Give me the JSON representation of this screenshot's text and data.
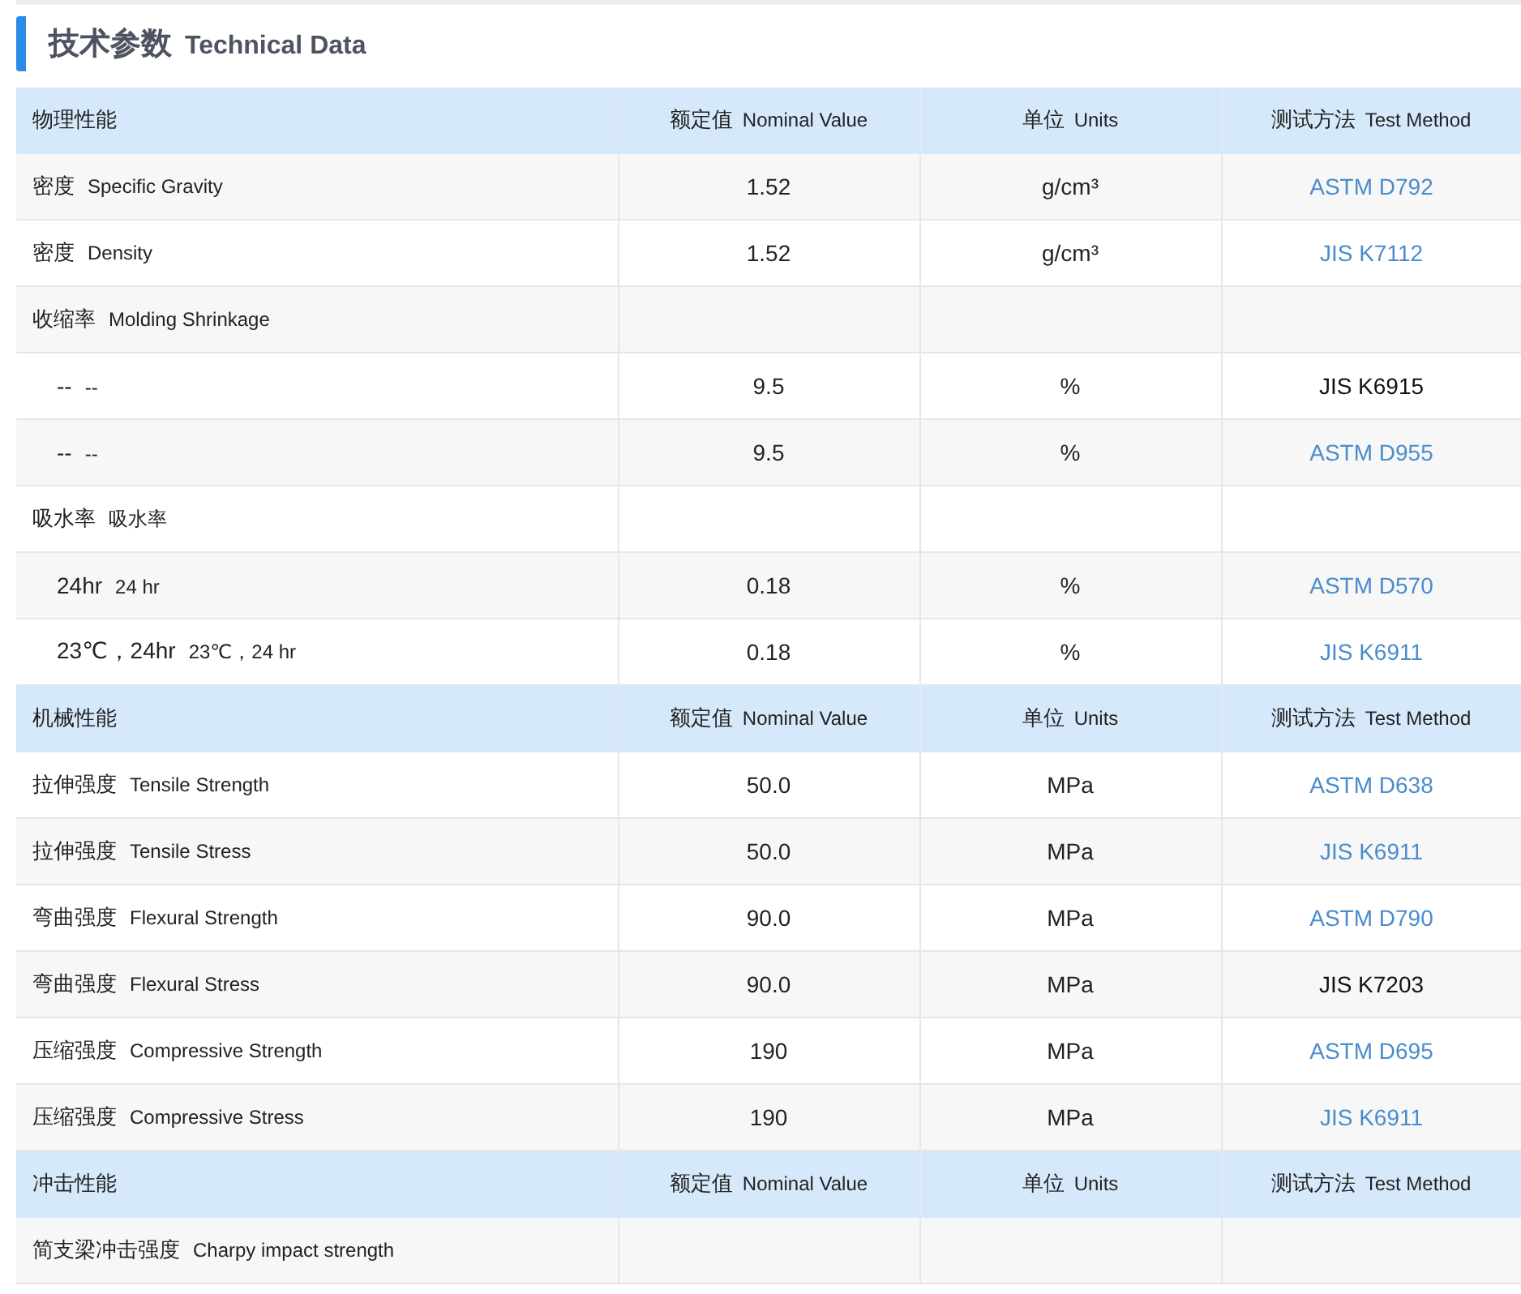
{
  "title": {
    "cn": "技术参数",
    "en": "Technical Data"
  },
  "sections": [
    {
      "header": {
        "category": "物理性能",
        "value": {
          "cn": "额定值",
          "en": "Nominal Value"
        },
        "unit": {
          "cn": "单位",
          "en": "Units"
        },
        "method": {
          "cn": "测试方法",
          "en": "Test Method"
        }
      },
      "rows": [
        {
          "cn": "密度",
          "en": "Specific Gravity",
          "value": "1.52",
          "unit": "g/cm³",
          "method": "ASTM D792",
          "link": true
        },
        {
          "cn": "密度",
          "en": "Density",
          "value": "1.52",
          "unit": "g/cm³",
          "method": "JIS K7112",
          "link": true
        },
        {
          "cn": "收缩率",
          "en": "Molding Shrinkage",
          "children": [
            {
              "cn": "--",
              "en": "--",
              "value": "9.5",
              "unit": "%",
              "method": "JIS K6915",
              "link": false
            },
            {
              "cn": "--",
              "en": "--",
              "value": "9.5",
              "unit": "%",
              "method": "ASTM D955",
              "link": true
            }
          ]
        },
        {
          "cn": "吸水率",
          "en": "吸水率",
          "children": [
            {
              "cn": "24hr",
              "en": "24 hr",
              "value": "0.18",
              "unit": "%",
              "method": "ASTM D570",
              "link": true
            },
            {
              "cn": "23℃，24hr",
              "en": "23℃，24 hr",
              "value": "0.18",
              "unit": "%",
              "method": "JIS K6911",
              "link": true
            }
          ]
        }
      ]
    },
    {
      "header": {
        "category": "机械性能",
        "value": {
          "cn": "额定值",
          "en": "Nominal Value"
        },
        "unit": {
          "cn": "单位",
          "en": "Units"
        },
        "method": {
          "cn": "测试方法",
          "en": "Test Method"
        }
      },
      "rows": [
        {
          "cn": "拉伸强度",
          "en": "Tensile Strength",
          "value": "50.0",
          "unit": "MPa",
          "method": "ASTM D638",
          "link": true
        },
        {
          "cn": "拉伸强度",
          "en": "Tensile Stress",
          "value": "50.0",
          "unit": "MPa",
          "method": "JIS K6911",
          "link": true
        },
        {
          "cn": "弯曲强度",
          "en": "Flexural Strength",
          "value": "90.0",
          "unit": "MPa",
          "method": "ASTM D790",
          "link": true
        },
        {
          "cn": "弯曲强度",
          "en": "Flexural Stress",
          "value": "90.0",
          "unit": "MPa",
          "method": "JIS K7203",
          "link": false
        },
        {
          "cn": "压缩强度",
          "en": "Compressive Strength",
          "value": "190",
          "unit": "MPa",
          "method": "ASTM D695",
          "link": true
        },
        {
          "cn": "压缩强度",
          "en": "Compressive Stress",
          "value": "190",
          "unit": "MPa",
          "method": "JIS K6911",
          "link": true
        }
      ]
    },
    {
      "header": {
        "category": "冲击性能",
        "value": {
          "cn": "额定值",
          "en": "Nominal Value"
        },
        "unit": {
          "cn": "单位",
          "en": "Units"
        },
        "method": {
          "cn": "测试方法",
          "en": "Test Method"
        }
      },
      "rows": [
        {
          "cn": "简支梁冲击强度",
          "en": "Charpy impact strength"
        }
      ]
    }
  ]
}
